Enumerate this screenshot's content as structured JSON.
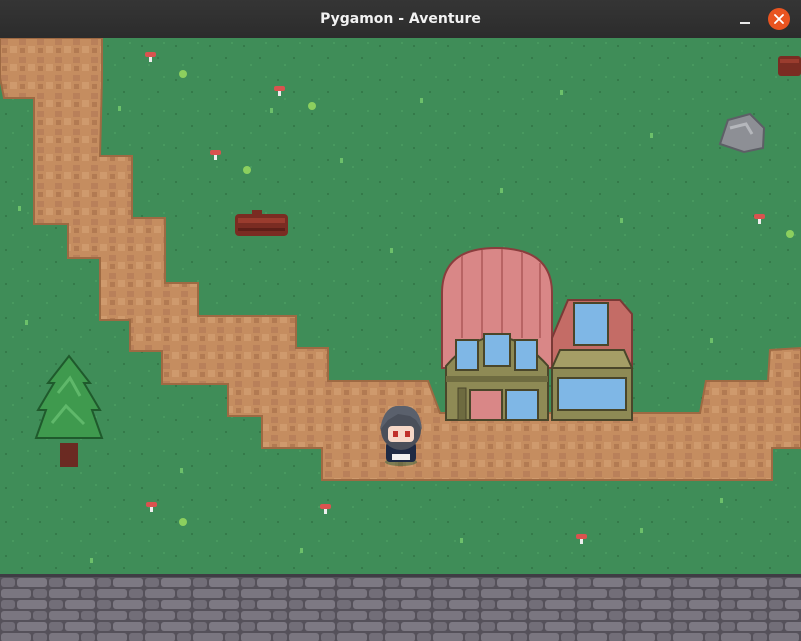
{
  "window": {
    "title": "Pygamon - Aventure",
    "minimize_icon": "minimize-icon",
    "close_icon": "close-icon",
    "accent_close": "#e95420"
  },
  "scene": {
    "palette": {
      "grass": "#3f8d58",
      "path": "#c58d60",
      "path_edge": "#9e6a43",
      "roof": "#d77f7f",
      "house_wall": "#8e8a55",
      "stone_wall": "#6f6b72"
    },
    "objects": [
      "dirt-path",
      "house",
      "pine-tree",
      "fallen-log",
      "boulder",
      "mushrooms",
      "stone-wall",
      "player-character"
    ]
  }
}
